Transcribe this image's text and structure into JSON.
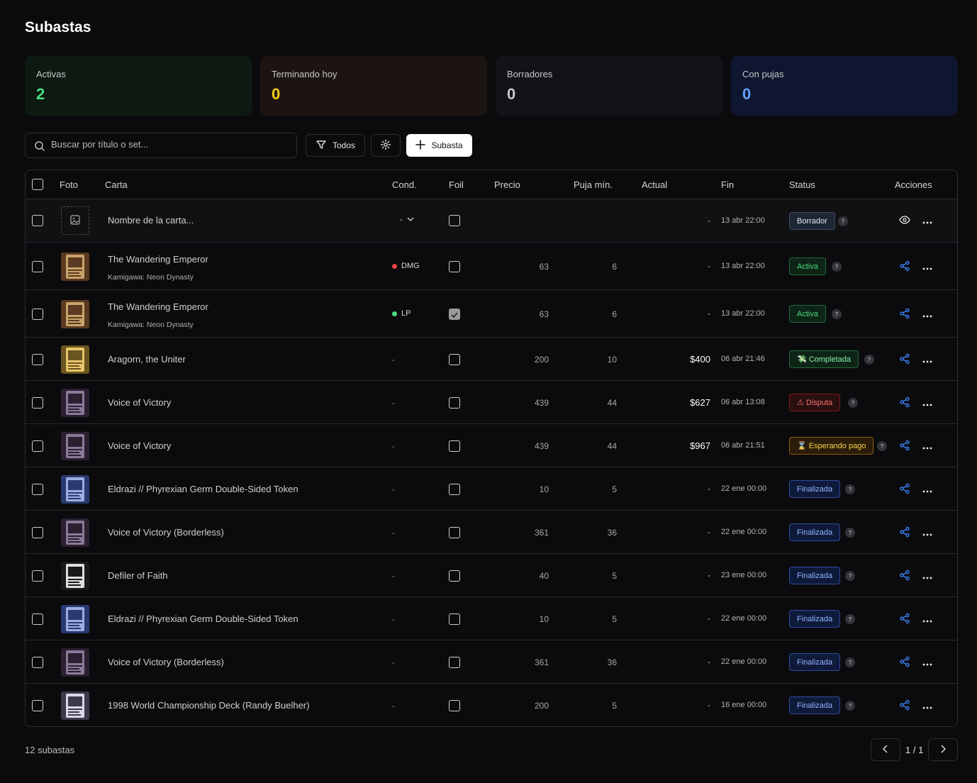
{
  "page": {
    "title": "Subastas"
  },
  "stats": [
    {
      "label": "Activas",
      "value": "2"
    },
    {
      "label": "Terminando hoy",
      "value": "0"
    },
    {
      "label": "Borradores",
      "value": "0"
    },
    {
      "label": "Con pujas",
      "value": "0"
    }
  ],
  "toolbar": {
    "search_placeholder": "Buscar por título o set...",
    "filter_label": "Todos",
    "add_label": "Subasta"
  },
  "columns": {
    "foto": "Foto",
    "carta": "Carta",
    "cond": "Cond.",
    "foil": "Foil",
    "precio": "Precio",
    "puja": "Puja mín.",
    "actual": "Actual",
    "fin": "Fin",
    "status": "Status",
    "acciones": "Acciones"
  },
  "draft_row": {
    "placeholder": "Nombre de la carta...",
    "cond": "-",
    "actual": "-",
    "fin": "13 abr 22:00",
    "status": "Borrador",
    "help": "?"
  },
  "rows": [
    {
      "name": "The Wandering Emperor",
      "set": "Kamigawa: Neon Dynasty",
      "cond": "DMG",
      "cond_color": "#ef4444",
      "foil": false,
      "precio": "63",
      "puja": "6",
      "actual": "-",
      "fin": "13 abr 22:00",
      "status": "Activa",
      "status_icon": "",
      "status_kind": "active",
      "help": "?"
    },
    {
      "name": "The Wandering Emperor",
      "set": "Kamigawa: Neon Dynasty",
      "cond": "LP",
      "cond_color": "#4ade80",
      "foil": true,
      "precio": "63",
      "puja": "6",
      "actual": "-",
      "fin": "13 abr 22:00",
      "status": "Activa",
      "status_icon": "",
      "status_kind": "active",
      "help": "?"
    },
    {
      "name": "Aragorn, the Uniter",
      "set": "",
      "cond": "-",
      "cond_color": "",
      "foil": false,
      "precio": "200",
      "puja": "10",
      "actual": "$400",
      "fin": "06 abr 21:46",
      "status": "Completada",
      "status_icon": "💸",
      "status_kind": "done",
      "help": "?"
    },
    {
      "name": "Voice of Victory",
      "set": "",
      "cond": "-",
      "cond_color": "",
      "foil": false,
      "precio": "439",
      "puja": "44",
      "actual": "$627",
      "fin": "06 abr 13:08",
      "status": "Disputa",
      "status_icon": "⚠",
      "status_kind": "dispute",
      "help": "?"
    },
    {
      "name": "Voice of Victory",
      "set": "",
      "cond": "-",
      "cond_color": "",
      "foil": false,
      "precio": "439",
      "puja": "44",
      "actual": "$967",
      "fin": "06 abr 21:51",
      "status": "Esperando pago",
      "status_icon": "⌛",
      "status_kind": "wait",
      "help": "?"
    },
    {
      "name": "Eldrazi // Phyrexian Germ Double-Sided Token",
      "set": "",
      "cond": "-",
      "cond_color": "",
      "foil": false,
      "precio": "10",
      "puja": "5",
      "actual": "-",
      "fin": "22 ene 00:00",
      "status": "Finalizada",
      "status_icon": "",
      "status_kind": "final",
      "help": "?"
    },
    {
      "name": "Voice of Victory (Borderless)",
      "set": "",
      "cond": "-",
      "cond_color": "",
      "foil": false,
      "precio": "361",
      "puja": "36",
      "actual": "-",
      "fin": "22 ene 00:00",
      "status": "Finalizada",
      "status_icon": "",
      "status_kind": "final",
      "help": "?"
    },
    {
      "name": "Defiler of Faith",
      "set": "",
      "cond": "-",
      "cond_color": "",
      "foil": false,
      "precio": "40",
      "puja": "5",
      "actual": "-",
      "fin": "23 ene 00:00",
      "status": "Finalizada",
      "status_icon": "",
      "status_kind": "final",
      "help": "?"
    },
    {
      "name": "Eldrazi // Phyrexian Germ Double-Sided Token",
      "set": "",
      "cond": "-",
      "cond_color": "",
      "foil": false,
      "precio": "10",
      "puja": "5",
      "actual": "-",
      "fin": "22 ene 00:00",
      "status": "Finalizada",
      "status_icon": "",
      "status_kind": "final",
      "help": "?"
    },
    {
      "name": "Voice of Victory (Borderless)",
      "set": "",
      "cond": "-",
      "cond_color": "",
      "foil": false,
      "precio": "361",
      "puja": "36",
      "actual": "-",
      "fin": "22 ene 00:00",
      "status": "Finalizada",
      "status_icon": "",
      "status_kind": "final",
      "help": "?"
    },
    {
      "name": "1998 World Championship Deck (Randy Buelher)",
      "set": "",
      "cond": "-",
      "cond_color": "",
      "foil": false,
      "precio": "200",
      "puja": "5",
      "actual": "-",
      "fin": "16 ene 00:00",
      "status": "Finalizada",
      "status_icon": "",
      "status_kind": "final",
      "help": "?"
    }
  ],
  "footer": {
    "count": "12 subastas",
    "page": "1 / 1"
  },
  "colors": {
    "accent_blue": "#3b82f6",
    "active_green": "#4ade80",
    "warning_amber": "#facc15"
  }
}
